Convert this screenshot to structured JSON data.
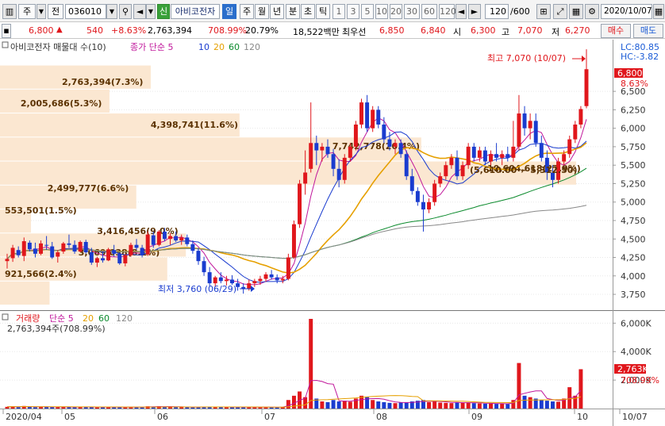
{
  "toolbar": {
    "type_label": "주",
    "market_label": "전",
    "code": "036010",
    "badge": "신",
    "stock_name": "아비코전자",
    "period_buttons": [
      "일",
      "주",
      "월",
      "년",
      "분",
      "초",
      "틱"
    ],
    "selected_period": "일",
    "interval_buttons": [
      "1",
      "3",
      "5",
      "10",
      "20",
      "30",
      "60",
      "120"
    ],
    "count": "120",
    "count_max": "/600",
    "date": "2020/10/07"
  },
  "quote": {
    "price": "6,800",
    "change_arrow": "▲",
    "change": "540",
    "change_pct": "+8.63%",
    "volume": "2,763,394",
    "volume_pct": "708.99%",
    "turnover": "20.79%",
    "amount": "18,522백만",
    "best_label": "최우선",
    "best_ask": "6,850",
    "best_bid": "6,840",
    "open_label": "시",
    "open": "6,300",
    "high_label": "고",
    "high": "7,070",
    "low_label": "저",
    "low": "6,270",
    "buy_button": "매수",
    "sell_button": "매도"
  },
  "price_panel": {
    "legend_name": "아비코전자 매물대 수(10)",
    "legend_ma": "종가 단순 5",
    "legend_periods": [
      "10",
      "20",
      "60",
      "120"
    ],
    "lc": "LC:80.85",
    "hc": "HC:-3.82",
    "current_tag": "6,800",
    "current_pct": "8.63%",
    "high_annotation": "최고 7,070 (10/07)",
    "low_annotation": "최저 3,760 (06/29)",
    "y_ticks": [
      "6,500",
      "6,250",
      "6,000",
      "5,750",
      "5,500",
      "5,250",
      "5,000",
      "4,750",
      "4,500",
      "4,250",
      "4,000",
      "3,750"
    ]
  },
  "volume_profile": [
    {
      "label": "2,763,394(7.3%)",
      "pct": 7.3
    },
    {
      "label": "2,005,686(5.3%)",
      "pct": 5.3
    },
    {
      "label": "4,398,741(11.6%)",
      "pct": 11.6
    },
    {
      "label": "7,742,778(20.4%)",
      "pct": 20.4
    },
    {
      "label": "10,604,618(27.9%)",
      "pct": 27.9
    },
    {
      "label": "2,499,777(6.6%)",
      "pct": 6.6
    },
    {
      "label": "553,501(1.5%)",
      "pct": 1.5
    },
    {
      "label": "3,416,456(9.0%)",
      "pct": 9.0
    },
    {
      "label": "3,069,038(8.1%)",
      "pct": 8.1
    },
    {
      "label": "921,566(2.4%)",
      "pct": 2.4
    }
  ],
  "range_annotation": "(5,610.00 ~ 5,312.50)",
  "volume_panel": {
    "legend_name": "거래량",
    "legend_ma": "단순 5",
    "legend_periods": [
      "20",
      "60",
      "120"
    ],
    "volume_text": "2,763,394주(708.99%)",
    "current_tag": "2,763K",
    "current_pct": "708.99%",
    "y_ticks": [
      "6,000K",
      "4,000K",
      "2,000K"
    ]
  },
  "x_axis": [
    "2020/04",
    "05",
    "06",
    "07",
    "08",
    "09",
    "10",
    "10/07"
  ],
  "chart_data": {
    "type": "candlestick",
    "ylim": [
      3600,
      7200
    ],
    "candles": [
      [
        4200,
        4300,
        4100,
        4230
      ],
      [
        4240,
        4420,
        4190,
        4380
      ],
      [
        4350,
        4400,
        4250,
        4280
      ],
      [
        4270,
        4520,
        4200,
        4470
      ],
      [
        4450,
        4480,
        4330,
        4360
      ],
      [
        4370,
        4450,
        4250,
        4300
      ],
      [
        4300,
        4480,
        4280,
        4440
      ],
      [
        4420,
        4540,
        4350,
        4410
      ],
      [
        4400,
        4460,
        4230,
        4250
      ],
      [
        4260,
        4350,
        4180,
        4320
      ],
      [
        4330,
        4460,
        4300,
        4440
      ],
      [
        4440,
        4560,
        4380,
        4420
      ],
      [
        4420,
        4480,
        4300,
        4330
      ],
      [
        4330,
        4480,
        4320,
        4460
      ],
      [
        4460,
        4490,
        4300,
        4320
      ],
      [
        4320,
        4380,
        4150,
        4180
      ],
      [
        4180,
        4260,
        4120,
        4240
      ],
      [
        4240,
        4330,
        4180,
        4210
      ],
      [
        4210,
        4380,
        4200,
        4360
      ],
      [
        4350,
        4420,
        4260,
        4300
      ],
      [
        4300,
        4320,
        4150,
        4170
      ],
      [
        4170,
        4300,
        4130,
        4280
      ],
      [
        4280,
        4450,
        4260,
        4420
      ],
      [
        4420,
        4500,
        4350,
        4380
      ],
      [
        4380,
        4420,
        4250,
        4280
      ],
      [
        4290,
        4600,
        4270,
        4560
      ],
      [
        4550,
        4600,
        4380,
        4420
      ],
      [
        4420,
        4620,
        4400,
        4600
      ],
      [
        4600,
        4650,
        4470,
        4500
      ],
      [
        4500,
        4580,
        4420,
        4540
      ],
      [
        4540,
        4600,
        4460,
        4480
      ],
      [
        4480,
        4560,
        4420,
        4520
      ],
      [
        4520,
        4560,
        4400,
        4430
      ],
      [
        4430,
        4480,
        4300,
        4340
      ],
      [
        4340,
        4380,
        4150,
        4200
      ],
      [
        4200,
        4260,
        4000,
        4050
      ],
      [
        4050,
        4120,
        3860,
        3900
      ],
      [
        3900,
        4000,
        3850,
        3980
      ],
      [
        3980,
        4050,
        3900,
        3930
      ],
      [
        3930,
        4000,
        3870,
        3950
      ],
      [
        3950,
        4010,
        3880,
        3900
      ],
      [
        3900,
        3960,
        3800,
        3850
      ],
      [
        3850,
        3900,
        3760,
        3820
      ],
      [
        3820,
        3950,
        3800,
        3900
      ],
      [
        3900,
        3960,
        3850,
        3930
      ],
      [
        3930,
        4000,
        3880,
        3960
      ],
      [
        3960,
        4050,
        3920,
        4020
      ],
      [
        4020,
        4080,
        3950,
        3980
      ],
      [
        3980,
        4020,
        3900,
        3940
      ],
      [
        3940,
        4000,
        3900,
        3960
      ],
      [
        3960,
        4300,
        3940,
        4250
      ],
      [
        4250,
        4750,
        4230,
        4700
      ],
      [
        4700,
        5300,
        4650,
        5250
      ],
      [
        5250,
        5700,
        5100,
        5400
      ],
      [
        5450,
        6350,
        5400,
        5800
      ],
      [
        5800,
        5900,
        5500,
        5700
      ],
      [
        5700,
        5800,
        5550,
        5750
      ],
      [
        5750,
        5850,
        5600,
        5650
      ],
      [
        5650,
        5720,
        5350,
        5450
      ],
      [
        5450,
        5580,
        5200,
        5300
      ],
      [
        5300,
        5650,
        5250,
        5600
      ],
      [
        5600,
        5800,
        5550,
        5750
      ],
      [
        5750,
        6100,
        5700,
        6050
      ],
      [
        6050,
        6400,
        6000,
        6350
      ],
      [
        6350,
        6450,
        5950,
        6000
      ],
      [
        6000,
        6300,
        5950,
        6250
      ],
      [
        6250,
        6300,
        6000,
        6050
      ],
      [
        6050,
        6150,
        5800,
        5850
      ],
      [
        5850,
        5950,
        5700,
        5750
      ],
      [
        5750,
        5850,
        5650,
        5800
      ],
      [
        5800,
        5850,
        5600,
        5650
      ],
      [
        5650,
        5700,
        5300,
        5350
      ],
      [
        5350,
        5450,
        5100,
        5150
      ],
      [
        5150,
        5200,
        4950,
        5000
      ],
      [
        5000,
        5100,
        4600,
        4900
      ],
      [
        4900,
        5050,
        4850,
        5000
      ],
      [
        5000,
        5300,
        4950,
        5250
      ],
      [
        5250,
        5400,
        5200,
        5350
      ],
      [
        5350,
        5550,
        5300,
        5500
      ],
      [
        5500,
        5650,
        5450,
        5600
      ],
      [
        5600,
        5700,
        5300,
        5350
      ],
      [
        5350,
        5550,
        5300,
        5500
      ],
      [
        5500,
        5800,
        5450,
        5750
      ],
      [
        5750,
        5800,
        5550,
        5600
      ],
      [
        5600,
        5750,
        5550,
        5700
      ],
      [
        5700,
        5750,
        5500,
        5550
      ],
      [
        5550,
        5700,
        5500,
        5650
      ],
      [
        5650,
        5800,
        5550,
        5600
      ],
      [
        5600,
        5700,
        5500,
        5650
      ],
      [
        5650,
        5750,
        5550,
        5600
      ],
      [
        5600,
        6100,
        5550,
        5750
      ],
      [
        5750,
        6450,
        5700,
        6200
      ],
      [
        6200,
        6300,
        5900,
        6000
      ],
      [
        6000,
        6200,
        5850,
        6100
      ],
      [
        6100,
        6200,
        5750,
        5800
      ],
      [
        5800,
        5900,
        5550,
        5600
      ],
      [
        5600,
        5700,
        5300,
        5400
      ],
      [
        5400,
        5500,
        5200,
        5300
      ],
      [
        5300,
        5600,
        5250,
        5550
      ],
      [
        5550,
        5700,
        5500,
        5650
      ],
      [
        5650,
        5900,
        5600,
        5850
      ],
      [
        5850,
        6100,
        5800,
        6050
      ],
      [
        6050,
        6300,
        6000,
        6260
      ],
      [
        6300,
        7070,
        6270,
        6800
      ]
    ],
    "volumes_k": [
      120,
      150,
      100,
      180,
      110,
      90,
      140,
      130,
      100,
      90,
      120,
      110,
      95,
      130,
      100,
      90,
      80,
      85,
      110,
      95,
      90,
      85,
      120,
      110,
      95,
      160,
      130,
      170,
      120,
      110,
      100,
      105,
      95,
      90,
      110,
      120,
      140,
      90,
      85,
      95,
      90,
      100,
      110,
      90,
      85,
      95,
      100,
      90,
      85,
      120,
      600,
      900,
      1200,
      800,
      6300,
      700,
      500,
      450,
      600,
      500,
      550,
      480,
      700,
      900,
      800,
      600,
      500,
      450,
      400,
      380,
      420,
      450,
      500,
      550,
      600,
      450,
      500,
      420,
      400,
      380,
      450,
      400,
      420,
      380,
      360,
      340,
      350,
      330,
      340,
      320,
      600,
      3200,
      900,
      800,
      700,
      600,
      550,
      500,
      480,
      700,
      1500,
      900,
      2763
    ],
    "ma_series": [
      "5",
      "10",
      "20",
      "60",
      "120"
    ]
  }
}
